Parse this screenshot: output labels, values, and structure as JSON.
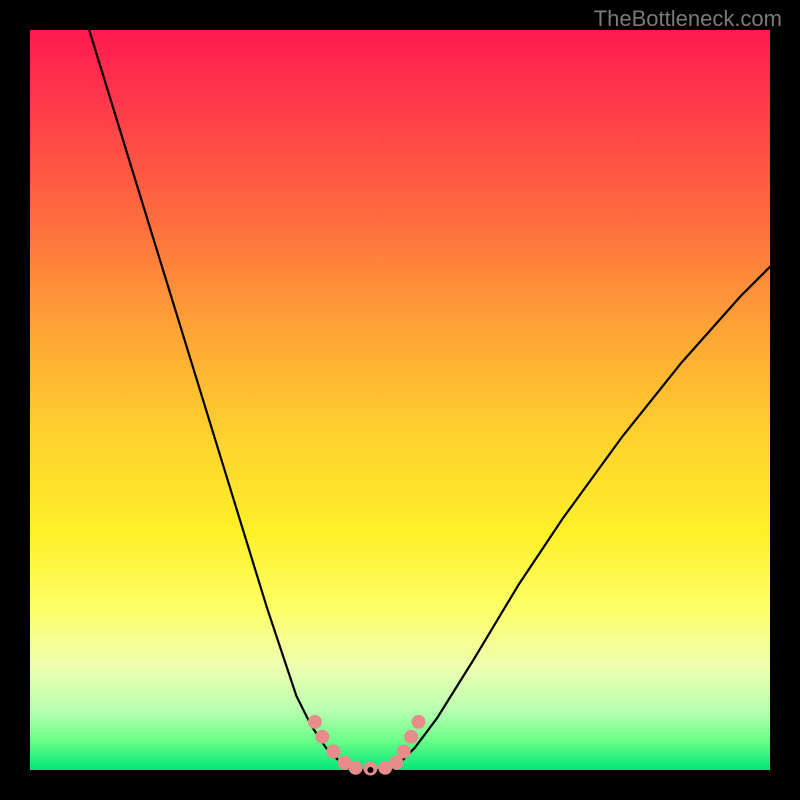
{
  "watermark": "TheBottleneck.com",
  "chart_data": {
    "type": "line",
    "title": "",
    "xlabel": "",
    "ylabel": "",
    "xlim": [
      0,
      100
    ],
    "ylim": [
      0,
      100
    ],
    "series": [
      {
        "name": "left-branch",
        "x": [
          8,
          12,
          16,
          20,
          24,
          28,
          32,
          34,
          36,
          38,
          40,
          42,
          43.5
        ],
        "y": [
          100,
          87,
          74,
          61,
          48,
          35,
          22,
          16,
          10,
          6,
          3,
          1,
          0
        ]
      },
      {
        "name": "right-branch",
        "x": [
          49,
          50,
          52,
          55,
          60,
          66,
          72,
          80,
          88,
          96,
          100
        ],
        "y": [
          0,
          1,
          3,
          7,
          15,
          25,
          34,
          45,
          55,
          64,
          68
        ]
      },
      {
        "name": "floor",
        "x": [
          43.5,
          49
        ],
        "y": [
          0,
          0
        ]
      }
    ],
    "markers": {
      "name": "pink-dotted-valley",
      "color": "#e88b8b",
      "points_x": [
        38.5,
        39.5,
        41,
        42.5,
        44,
        46,
        48,
        49.5,
        50.5,
        51.5,
        52.5
      ],
      "points_y": [
        6.5,
        4.5,
        2.5,
        1,
        0.3,
        0.2,
        0.3,
        1,
        2.5,
        4.5,
        6.5
      ]
    },
    "minimum_point": {
      "x": 46,
      "y": 0
    },
    "gradient_stops": [
      {
        "pos": 0,
        "color": "#ff1a4f"
      },
      {
        "pos": 25,
        "color": "#ff6a3f"
      },
      {
        "pos": 55,
        "color": "#ffd22e"
      },
      {
        "pos": 78,
        "color": "#fdff66"
      },
      {
        "pos": 100,
        "color": "#00e676"
      }
    ]
  }
}
